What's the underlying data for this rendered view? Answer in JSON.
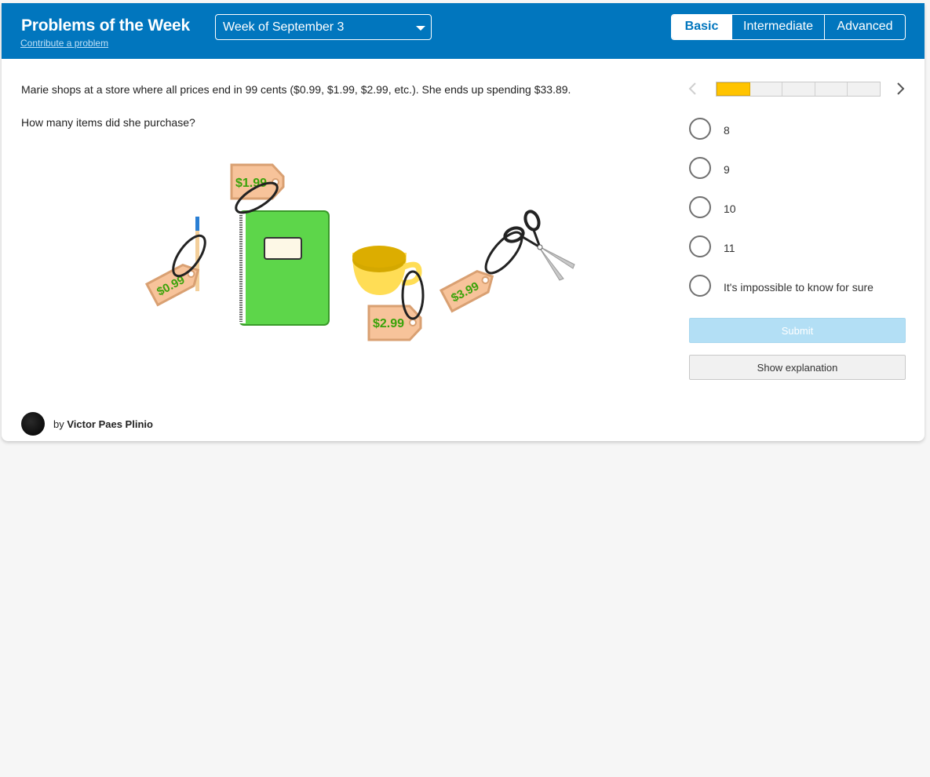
{
  "header": {
    "title": "Problems of the Week",
    "contribute_link": "Contribute a problem",
    "week_select": "Week of September 3",
    "levels": [
      "Basic",
      "Intermediate",
      "Advanced"
    ],
    "active_level": "Basic"
  },
  "problem": {
    "statement": "Marie shops at a store where all prices end in 99 cents ($0.99, $1.99, $2.99, etc.). She ends up spending $33.89.",
    "question": "How many items did she purchase?",
    "price_tags": [
      "$0.99",
      "$1.99",
      "$2.99",
      "$3.99"
    ]
  },
  "progress": {
    "current": 1,
    "total": 5
  },
  "answers": {
    "options": [
      "8",
      "9",
      "10",
      "11",
      "It's impossible to know for sure"
    ]
  },
  "buttons": {
    "submit": "Submit",
    "show_explanation": "Show explanation"
  },
  "author": {
    "by": "by",
    "name": "Victor Paes Plinio"
  },
  "colors": {
    "brand_blue": "#0176be",
    "progress_fill": "#ffc400",
    "submit_disabled": "#b3dff5",
    "price_text": "#3aa30a",
    "tag_fill": "#f7c39a"
  }
}
